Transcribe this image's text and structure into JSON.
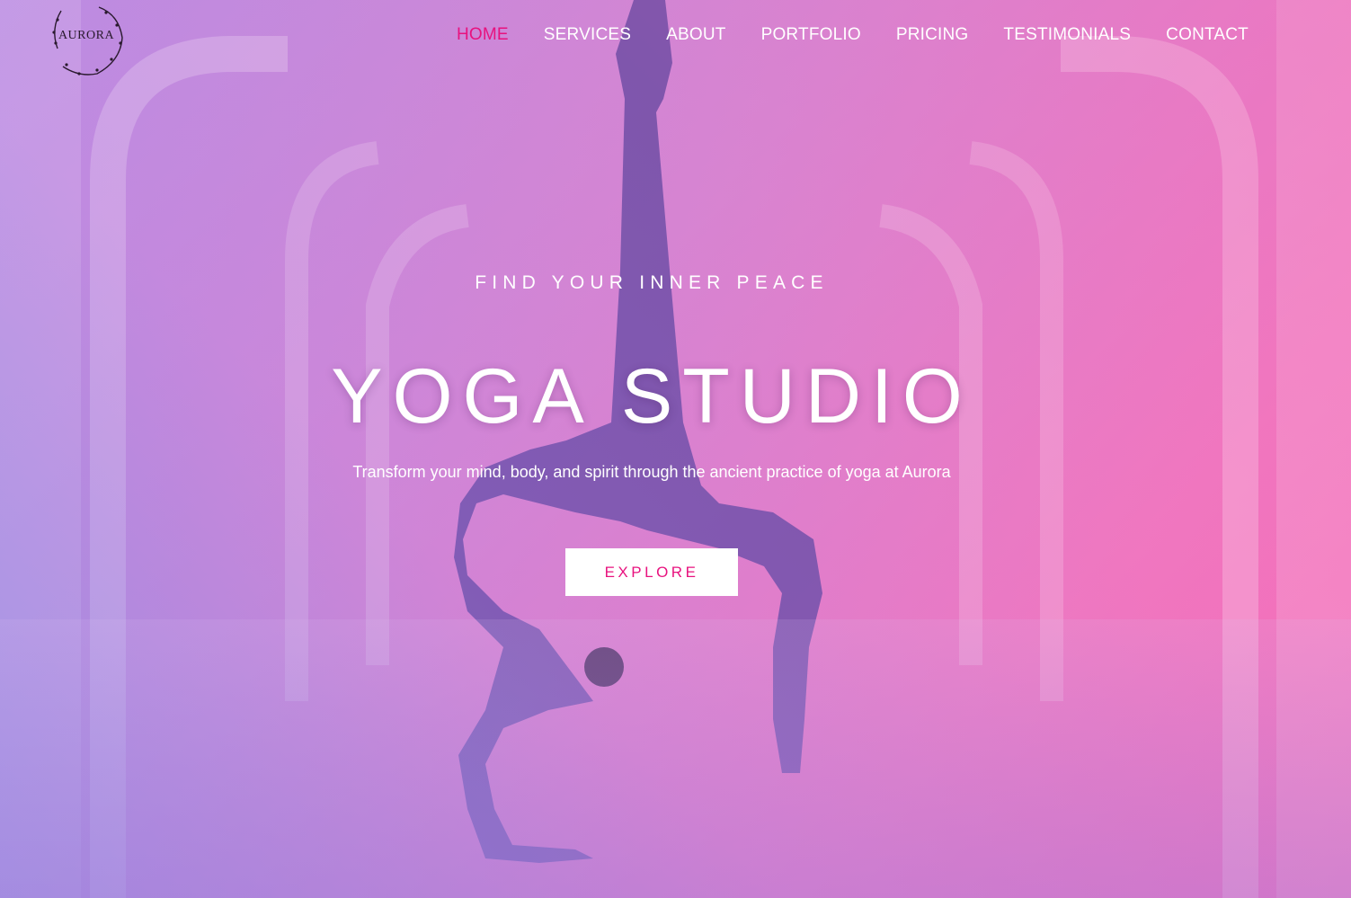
{
  "brand": {
    "logo_text": "AURORA"
  },
  "nav": {
    "items": [
      {
        "label": "HOME",
        "active": true
      },
      {
        "label": "SERVICES",
        "active": false
      },
      {
        "label": "ABOUT",
        "active": false
      },
      {
        "label": "PORTFOLIO",
        "active": false
      },
      {
        "label": "PRICING",
        "active": false
      },
      {
        "label": "TESTIMONIALS",
        "active": false
      },
      {
        "label": "CONTACT",
        "active": false
      }
    ]
  },
  "hero": {
    "eyebrow": "FIND YOUR INNER PEACE",
    "title": "YOGA STUDIO",
    "subtitle": "Transform your mind, body, and spirit through the ancient practice of yoga at Aurora",
    "cta_label": "EXPLORE",
    "background_image": "yoga-pose-photo"
  },
  "colors": {
    "accent": "#e8127e",
    "gradient_start": "#8fa0ea",
    "gradient_end": "#f66cb8",
    "button_bg": "#ffffff"
  }
}
